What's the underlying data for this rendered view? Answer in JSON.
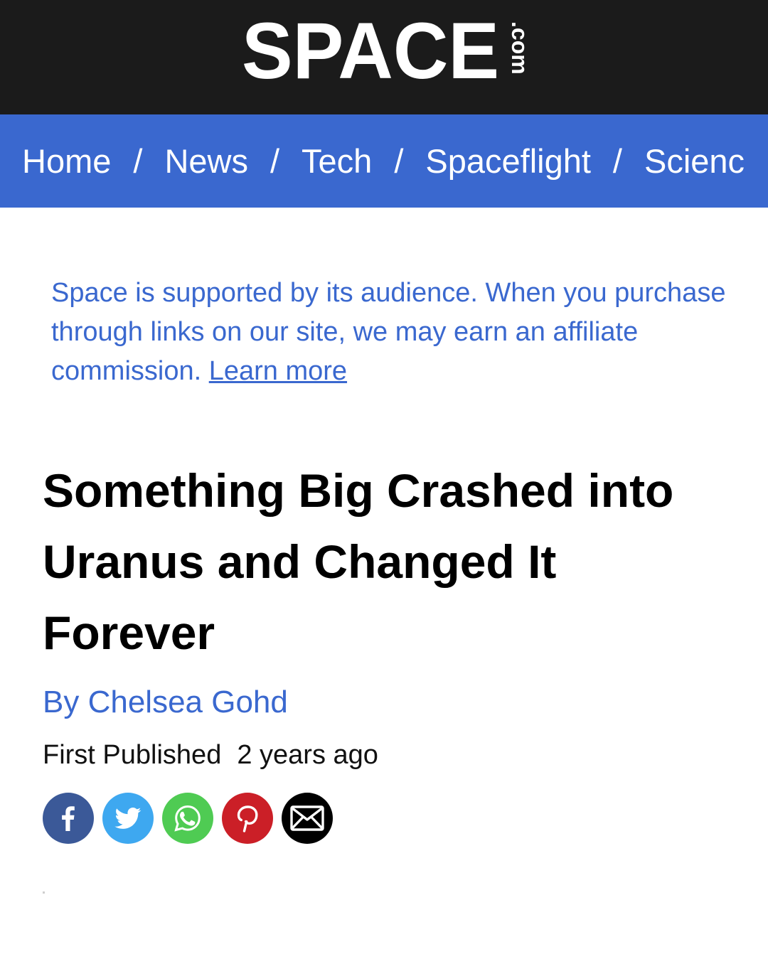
{
  "header": {
    "logo_text": "SPACE",
    "logo_suffix": ".com",
    "background": "#1b1b1b"
  },
  "nav": {
    "background": "#3a68cf",
    "items": [
      "Home",
      "News",
      "Tech",
      "Spaceflight",
      "Scienc"
    ],
    "separator": "/"
  },
  "affiliate": {
    "text": "Space is supported by its audience. When you purchase through links on our site, we may earn an affiliate commission. ",
    "link_label": "Learn more"
  },
  "article": {
    "title": "Something Big Crashed into Uranus and Changed It Forever",
    "byline_prefix": "By ",
    "author": "Chelsea Gohd",
    "published_label": "First Published",
    "published_value": "2 years ago"
  },
  "share": [
    {
      "icon": "facebook-icon",
      "color": "#3b5998"
    },
    {
      "icon": "twitter-icon",
      "color": "#3ea8f0"
    },
    {
      "icon": "whatsapp-icon",
      "color": "#4fcb53"
    },
    {
      "icon": "pinterest-icon",
      "color": "#cb1f27"
    },
    {
      "icon": "email-icon",
      "color": "#000000"
    }
  ]
}
